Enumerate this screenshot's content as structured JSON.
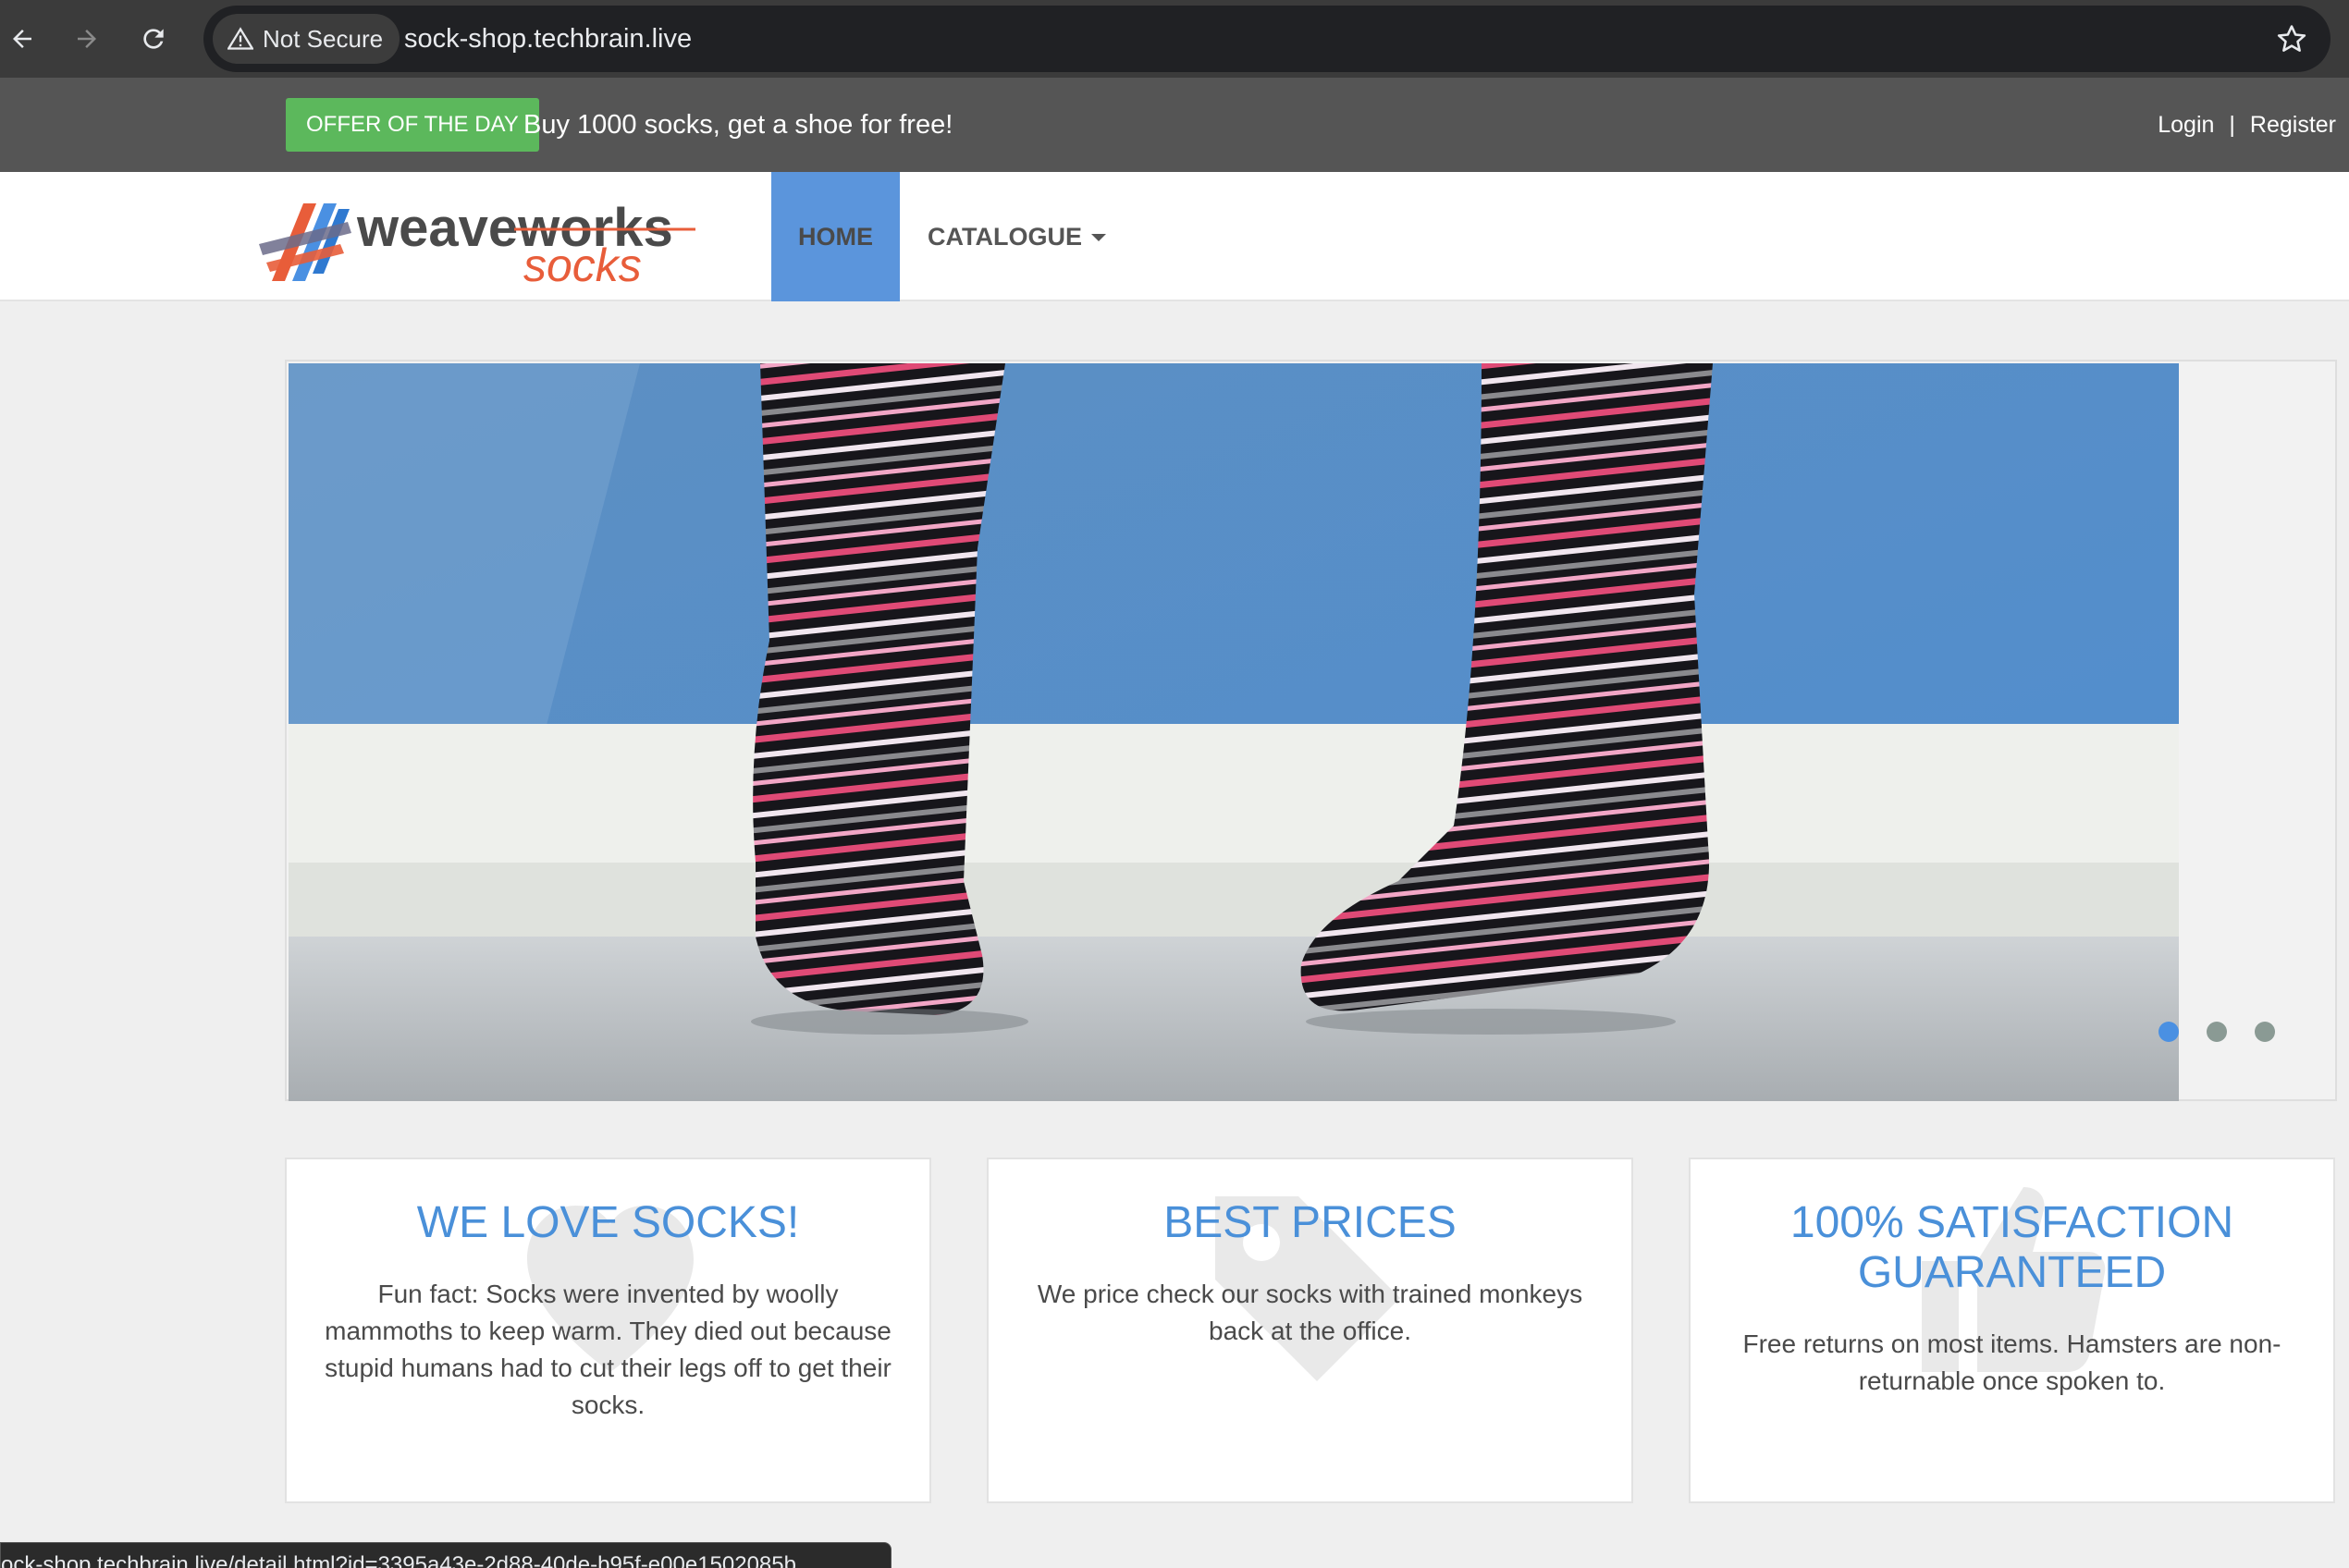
{
  "browser": {
    "security_label": "Not Secure",
    "url": "sock-shop.techbrain.live",
    "status_link": "ock-shop.techbrain.live/detail.html?id=3395a43e-2d88-40de-b95f-e00e1502085b"
  },
  "topbar": {
    "offer_badge": "OFFER OF THE DAY",
    "offer_text": "Buy 1000 socks, get a shoe for free!",
    "login": "Login",
    "separator": "|",
    "register": "Register"
  },
  "navbar": {
    "logo_word1": "weaveworks",
    "logo_word2": "socks",
    "home": "HOME",
    "catalogue": "CATALOGUE"
  },
  "carousel": {
    "slide_count": 3,
    "active_index": 0
  },
  "features": [
    {
      "title": "WE LOVE SOCKS!",
      "text": "Fun fact: Socks were invented by woolly mammoths to keep warm. They died out because stupid humans had to cut their legs off to get their socks.",
      "icon": "heart-icon"
    },
    {
      "title": "BEST PRICES",
      "text": "We price check our socks with trained monkeys back at the office.",
      "icon": "tag-icon"
    },
    {
      "title": "100% SATISFACTION GUARANTEED",
      "text": "Free returns on most items. Hamsters are non-returnable once spoken to.",
      "icon": "thumbs-up-icon"
    }
  ],
  "colors": {
    "accent_blue": "#5b95dc",
    "offer_green": "#5cb85c",
    "topbar_gray": "#555555",
    "logo_orange": "#e85d3a"
  }
}
